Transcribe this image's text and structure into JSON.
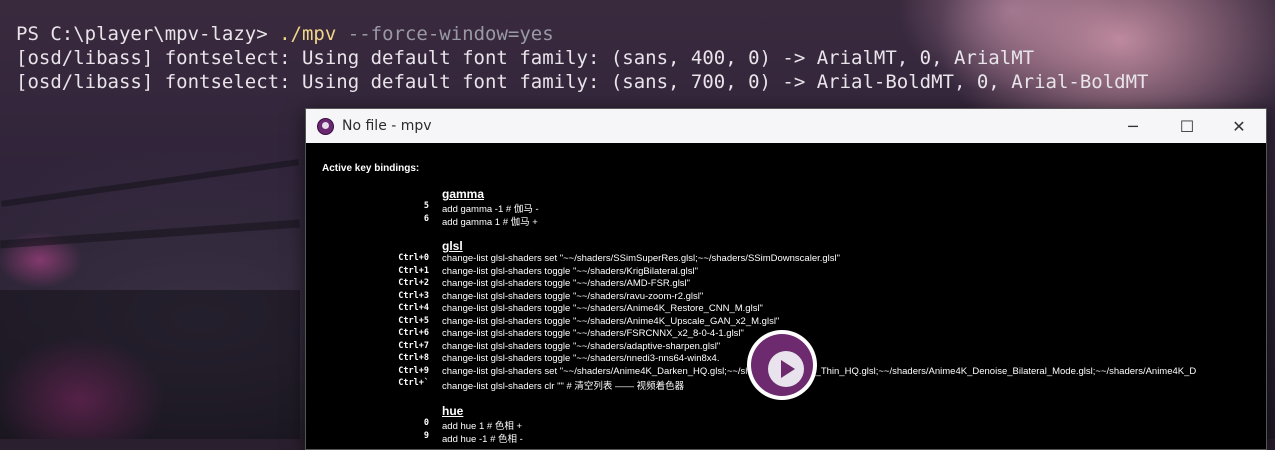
{
  "terminal": {
    "prompt": "PS C:\\player\\mpv-lazy> ",
    "command": "./mpv",
    "args": " --force-window=yes",
    "lines": [
      "[osd/libass] fontselect: Using default font family: (sans, 400, 0) -> ArialMT, 0, ArialMT",
      "[osd/libass] fontselect: Using default font family: (sans, 700, 0) -> Arial-BoldMT, 0, Arial-BoldMT"
    ]
  },
  "window": {
    "title": "No file - mpv",
    "minimize": "─",
    "maximize": "☐",
    "close": "✕",
    "accent": "#6d2a6f"
  },
  "osd": {
    "heading": "Active key bindings:",
    "groups": [
      {
        "title": "gamma",
        "bindings": [
          {
            "key": "5",
            "command": "add gamma -1  # 伽马 -"
          },
          {
            "key": "6",
            "command": "add gamma  1  # 伽马 +"
          }
        ]
      },
      {
        "title": "glsl",
        "bindings": [
          {
            "key": "Ctrl+0",
            "command": "change-list glsl-shaders set \"~~/shaders/SSimSuperRes.glsl;~~/shaders/SSimDownscaler.glsl\""
          },
          {
            "key": "Ctrl+1",
            "command": "change-list glsl-shaders toggle \"~~/shaders/KrigBilateral.glsl\""
          },
          {
            "key": "Ctrl+2",
            "command": "change-list glsl-shaders toggle \"~~/shaders/AMD-FSR.glsl\""
          },
          {
            "key": "Ctrl+3",
            "command": "change-list glsl-shaders toggle \"~~/shaders/ravu-zoom-r2.glsl\""
          },
          {
            "key": "Ctrl+4",
            "command": "change-list glsl-shaders toggle \"~~/shaders/Anime4K_Restore_CNN_M.glsl\""
          },
          {
            "key": "Ctrl+5",
            "command": "change-list glsl-shaders toggle \"~~/shaders/Anime4K_Upscale_GAN_x2_M.glsl\""
          },
          {
            "key": "Ctrl+6",
            "command": "change-list glsl-shaders toggle \"~~/shaders/FSRCNNX_x2_8-0-4-1.glsl\""
          },
          {
            "key": "Ctrl+7",
            "command": "change-list glsl-shaders toggle \"~~/shaders/adaptive-sharpen.glsl\""
          },
          {
            "key": "Ctrl+8",
            "command": "change-list glsl-shaders toggle \"~~/shaders/nnedi3-nns64-win8x4."
          },
          {
            "key": "Ctrl+9",
            "command": "change-list glsl-shaders set \"~~/shaders/Anime4K_Darken_HQ.glsl;~~/shaders/Anime4K_Thin_HQ.glsl;~~/shaders/Anime4K_Denoise_Bilateral_Mode.glsl;~~/shaders/Anime4K_D"
          },
          {
            "key": "Ctrl+`",
            "command": "change-list glsl-shaders clr \"\"  # 清空列表 —— 视频着色器"
          }
        ]
      },
      {
        "title": "hue",
        "bindings": [
          {
            "key": "0",
            "command": "add hue  1  # 色相 +"
          },
          {
            "key": "9",
            "command": "add hue -1  # 色相 -"
          }
        ]
      }
    ]
  },
  "overlay": {
    "icon": "play-icon"
  }
}
